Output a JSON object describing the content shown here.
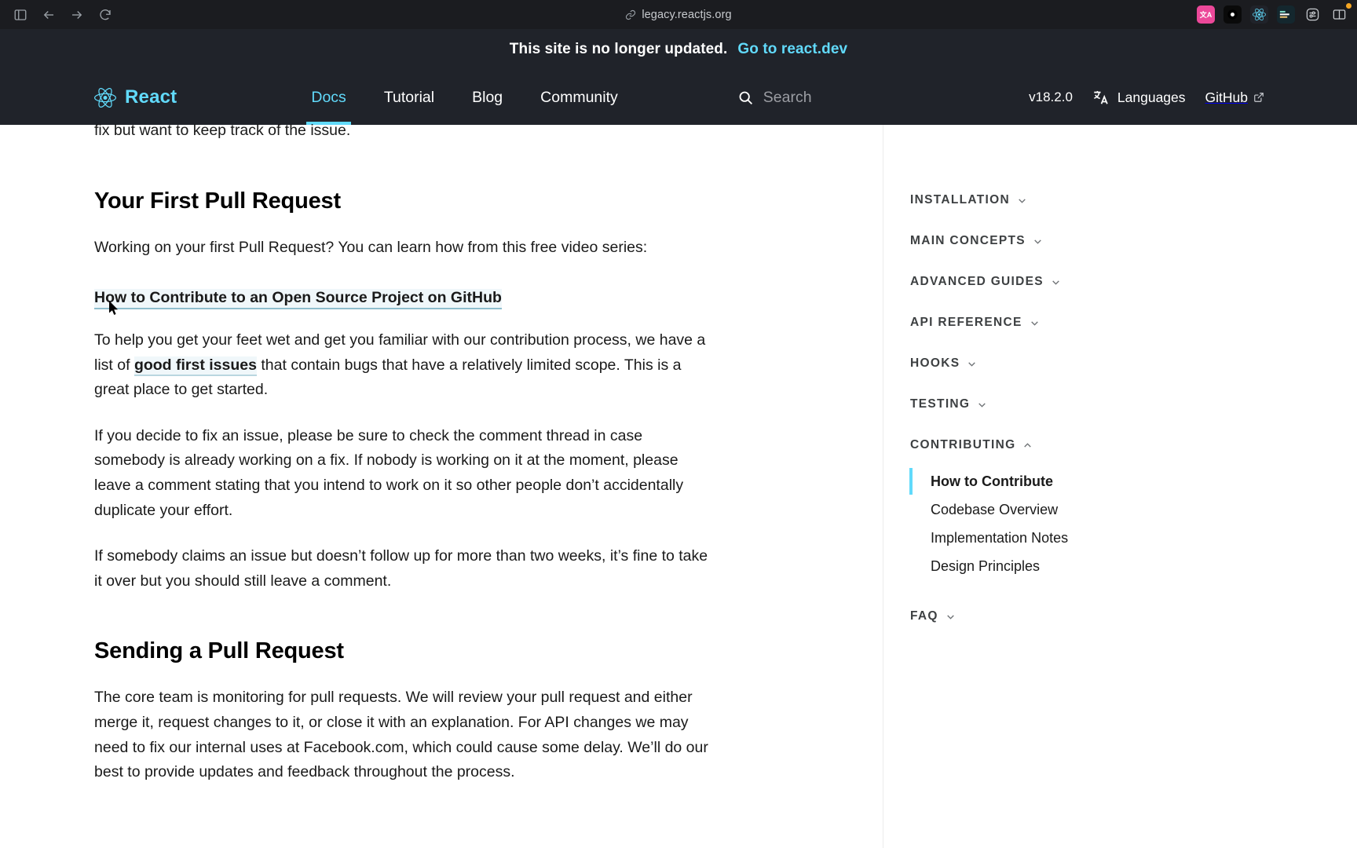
{
  "browser": {
    "url": "legacy.reactjs.org",
    "url_icon": "link-icon",
    "nav_buttons": [
      {
        "name": "sidebar-toggle-icon"
      },
      {
        "name": "back-icon"
      },
      {
        "name": "forward-icon"
      },
      {
        "name": "reload-icon"
      }
    ],
    "extensions": [
      {
        "name": "translate-extension-icon",
        "label": "文A",
        "color": "#ec4899"
      },
      {
        "name": "dark-reader-extension-icon",
        "label": "",
        "color": "#0a0a0a"
      },
      {
        "name": "react-devtools-extension-icon",
        "label": "",
        "color": "#20232a"
      },
      {
        "name": "color-picker-extension-icon",
        "label": "",
        "color": "#14272e"
      },
      {
        "name": "settings-extension-icon",
        "label": "",
        "color": "transparent"
      },
      {
        "name": "split-view-icon",
        "label": "",
        "color": "transparent"
      }
    ]
  },
  "banner": {
    "text": "This site is no longer updated.",
    "link_label": "Go to react.dev",
    "link_color": "#61dafb",
    "background": "#20232a"
  },
  "nav": {
    "brand": "React",
    "brand_icon": "react-logo-icon",
    "links": [
      {
        "label": "Docs",
        "active": true
      },
      {
        "label": "Tutorial",
        "active": false
      },
      {
        "label": "Blog",
        "active": false
      },
      {
        "label": "Community",
        "active": false
      }
    ],
    "search": {
      "icon": "search-icon",
      "placeholder": "Search",
      "value": ""
    },
    "version": "v18.2.0",
    "languages": {
      "icon": "translate-icon",
      "label": "Languages"
    },
    "github": {
      "label": "GitHub",
      "icon": "external-link-icon"
    },
    "accent_color": "#61dafb"
  },
  "article": {
    "clipped_line": "fix but want to keep track of the issue.",
    "sections": [
      {
        "heading": "Your First Pull Request",
        "intro": "Working on your first Pull Request? You can learn how from this free video series:",
        "video_link": "How to Contribute to an Open Source Project on GitHub",
        "paragraph_1_before": "To help you get your feet wet and get you familiar with our contribution process, we have a list of ",
        "paragraph_1_link": "good first issues",
        "paragraph_1_after": " that contain bugs that have a relatively limited scope. This is a great place to get started.",
        "paragraph_2": "If you decide to fix an issue, please be sure to check the comment thread in case somebody is already working on a fix. If nobody is working on it at the moment, please leave a comment stating that you intend to work on it so other people don’t accidentally duplicate your effort.",
        "paragraph_3": "If somebody claims an issue but doesn’t follow up for more than two weeks, it’s fine to take it over but you should still leave a comment."
      },
      {
        "heading": "Sending a Pull Request",
        "paragraph_1": "The core team is monitoring for pull requests. We will review your pull request and either merge it, request changes to it, or close it with an explanation. For API changes we may need to fix our internal uses at Facebook.com, which could cause some delay. We’ll do our best to provide updates and feedback throughout the process."
      }
    ]
  },
  "sidebar": {
    "sections": [
      {
        "label": "Installation",
        "expanded": false,
        "chevron": "chevron-down-icon",
        "items": []
      },
      {
        "label": "Main Concepts",
        "expanded": false,
        "chevron": "chevron-down-icon",
        "items": []
      },
      {
        "label": "Advanced Guides",
        "expanded": false,
        "chevron": "chevron-down-icon",
        "items": []
      },
      {
        "label": "API Reference",
        "expanded": false,
        "chevron": "chevron-down-icon",
        "items": []
      },
      {
        "label": "Hooks",
        "expanded": false,
        "chevron": "chevron-down-icon",
        "items": []
      },
      {
        "label": "Testing",
        "expanded": false,
        "chevron": "chevron-down-icon",
        "items": []
      },
      {
        "label": "Contributing",
        "expanded": true,
        "chevron": "chevron-up-icon",
        "items": [
          {
            "label": "How to Contribute",
            "active": true
          },
          {
            "label": "Codebase Overview",
            "active": false
          },
          {
            "label": "Implementation Notes",
            "active": false
          },
          {
            "label": "Design Principles",
            "active": false
          }
        ]
      },
      {
        "label": "FAQ",
        "expanded": false,
        "chevron": "chevron-down-icon",
        "items": []
      }
    ],
    "active_marker_color": "#61dafb"
  }
}
